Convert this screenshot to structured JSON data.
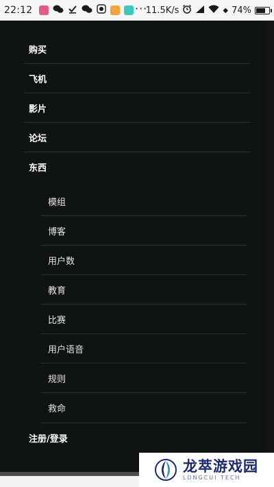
{
  "status_bar": {
    "time": "22:12",
    "overflow_dots": "···",
    "speed": "11.5K/s",
    "battery": "74%",
    "battery_level": 0.74
  },
  "menu": {
    "items": [
      {
        "label": "购买"
      },
      {
        "label": "飞机"
      },
      {
        "label": "影片"
      },
      {
        "label": "论坛"
      },
      {
        "label": "东西"
      }
    ],
    "submenu": [
      {
        "label": "模组"
      },
      {
        "label": "博客"
      },
      {
        "label": "用户数"
      },
      {
        "label": "教育"
      },
      {
        "label": "比赛"
      },
      {
        "label": "用户语音"
      },
      {
        "label": "规则"
      },
      {
        "label": "救命"
      }
    ],
    "footer_item": {
      "label": "注册/登录"
    }
  },
  "watermark": {
    "name": "龙萃游戏园",
    "subtitle": "LONGCUI TECH"
  },
  "colors": {
    "menu_bg": "#0f1413",
    "divider": "#2a302e",
    "text": "#ffffff",
    "brand": "#1a2a6c"
  }
}
